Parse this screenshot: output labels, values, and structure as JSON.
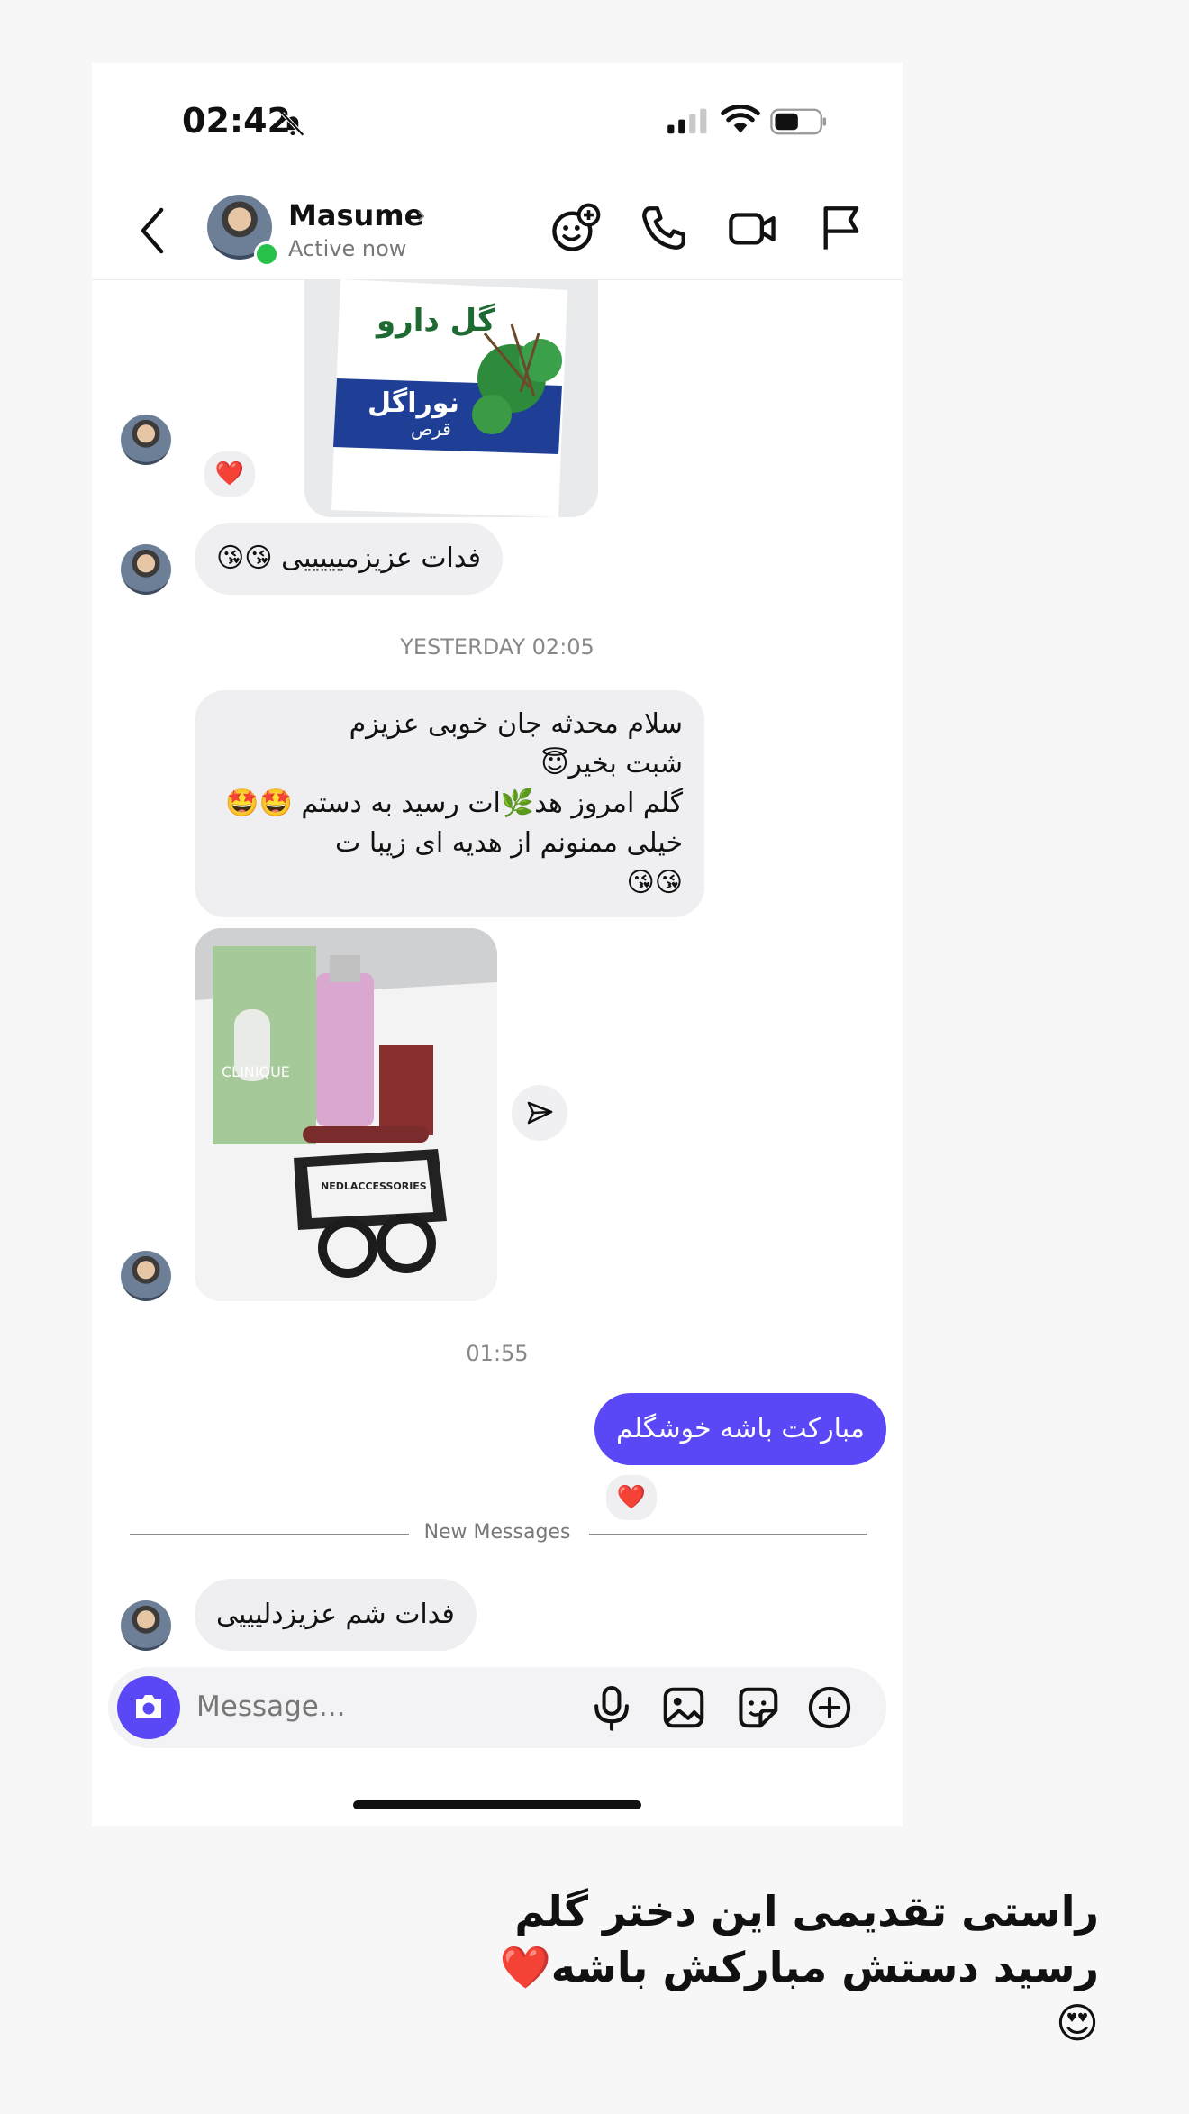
{
  "status_bar": {
    "time": "02:42"
  },
  "header": {
    "contact_name": "Masume",
    "presence": "Active now"
  },
  "messages": {
    "msg1_text": "فدات عزیزمیییییی 😘😘",
    "timestamp1": "YESTERDAY 02:05",
    "msg2_line1": "سلام محدثه جان خوبی عزیزم",
    "msg2_line2": "شبت بخیر😇",
    "msg2_line3": "گلم امروز هد🌿ات رسید به دستم 🤩🤩",
    "msg2_line4": "خیلی ممنونم از هدیه ای زیبا ت",
    "msg2_line5": "😘😘",
    "timestamp2": "01:55",
    "out_msg": "مبارکت باشه خوشگلم",
    "reaction": "❤️",
    "new_messages": "New Messages",
    "msg3_text": "فدات شم عزیزدلیییی"
  },
  "product_box": {
    "brand": "گل دارو",
    "product": "نوراگل",
    "form": "قرص"
  },
  "gift_photo": {
    "box_label": "CLINIQUE",
    "card_label": "NEDLACCESSORIES"
  },
  "composer": {
    "placeholder": "Message..."
  },
  "caption": {
    "line1": "راستی تقدیمی این دختر گلم",
    "line2": "رسید دستش مبارکش باشه❤️😍"
  },
  "colors": {
    "accent": "#5a47f5",
    "online": "#28c24a",
    "bubble_in": "#efeff2"
  },
  "icons": [
    "bell-off-icon",
    "signal-icon",
    "wifi-icon",
    "battery-icon",
    "back-icon",
    "effects-icon",
    "phone-icon",
    "video-icon",
    "flag-icon",
    "send-icon",
    "camera-icon",
    "mic-icon",
    "gallery-icon",
    "sticker-icon",
    "plus-icon"
  ]
}
